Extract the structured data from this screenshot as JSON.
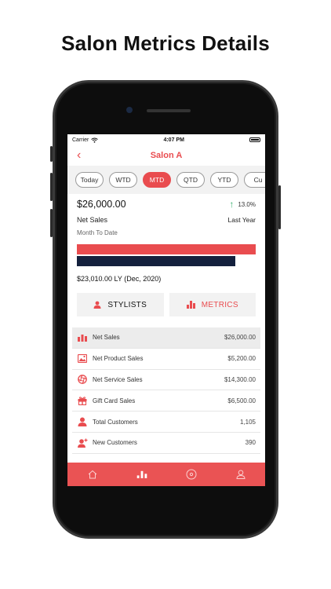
{
  "headline": "Salon Metrics Details",
  "status": {
    "carrier": "Carrier",
    "time": "4:07 PM"
  },
  "nav": {
    "title": "Salon A"
  },
  "tabs": [
    "Today",
    "WTD",
    "MTD",
    "QTD",
    "YTD",
    "Cu"
  ],
  "active_tab": "MTD",
  "summary": {
    "amount": "$26,000.00",
    "change": "13.0%",
    "net_label": "Net Sales",
    "ly_label": "Last Year",
    "period": "Month To Date",
    "ly_value_text": "$23,010.00 LY (Dec, 2020)",
    "current_ratio": 1.0,
    "ly_ratio": 0.885
  },
  "buttons": {
    "stylists": "STYLISTS",
    "metrics": "METRICS"
  },
  "metrics": [
    {
      "label": "Net Sales",
      "value": "$26,000.00",
      "icon": "bar-chart-icon"
    },
    {
      "label": "Net Product Sales",
      "value": "$5,200.00",
      "icon": "product-image-icon"
    },
    {
      "label": "Net Service Sales",
      "value": "$14,300.00",
      "icon": "aperture-icon"
    },
    {
      "label": "Gift Card Sales",
      "value": "$6,500.00",
      "icon": "gift-icon"
    },
    {
      "label": "Total Customers",
      "value": "1,105",
      "icon": "person-icon"
    },
    {
      "label": "New Customers",
      "value": "390",
      "icon": "person-add-icon"
    }
  ],
  "colors": {
    "accent": "#e94c4f",
    "navy": "#14213d",
    "up": "#3cb371"
  }
}
